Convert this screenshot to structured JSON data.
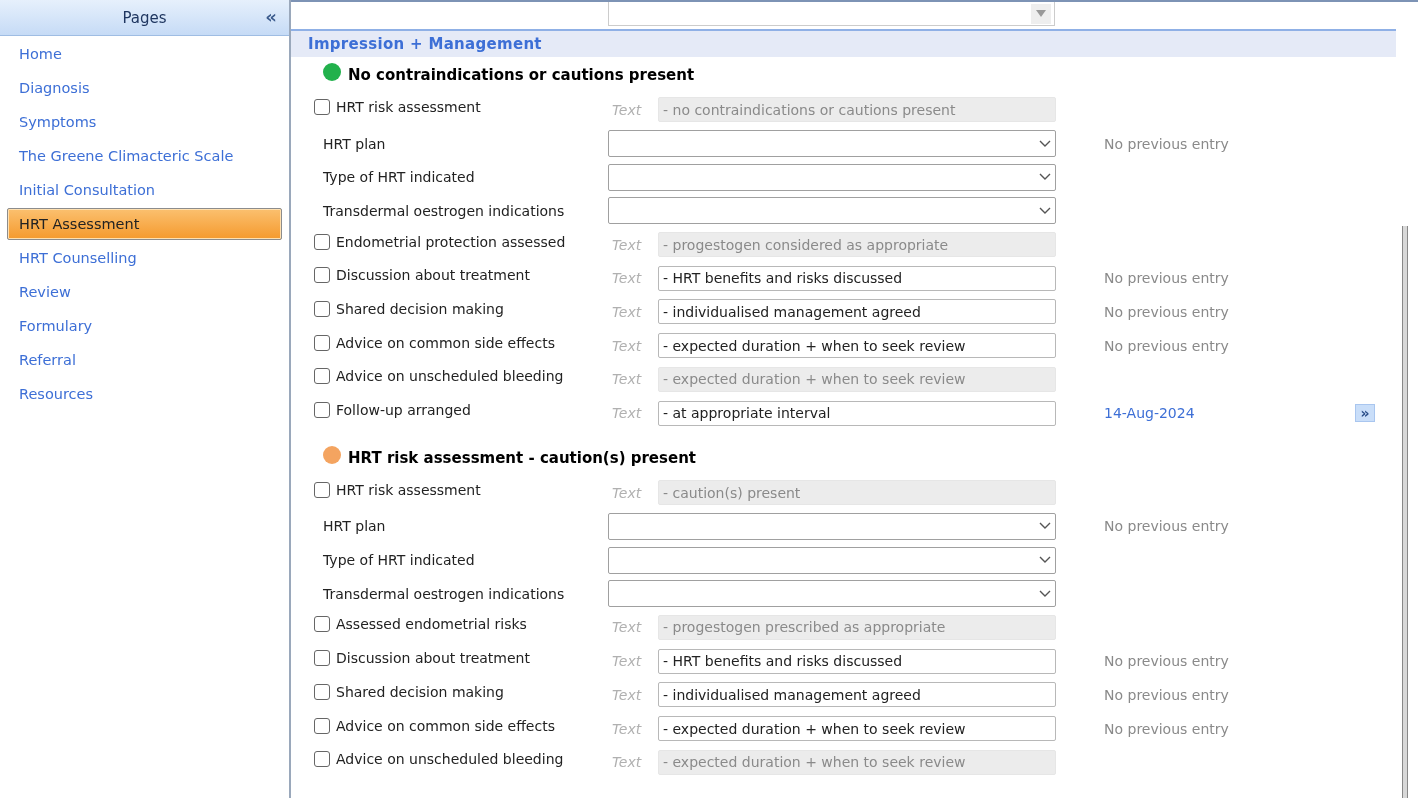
{
  "sidebar": {
    "title": "Pages",
    "collapse": "«",
    "items": [
      {
        "label": "Home",
        "selected": false
      },
      {
        "label": "Diagnosis",
        "selected": false
      },
      {
        "label": "Symptoms",
        "selected": false
      },
      {
        "label": "The Greene Climacteric Scale",
        "selected": false
      },
      {
        "label": "Initial Consultation",
        "selected": false
      },
      {
        "label": "HRT Assessment",
        "selected": true
      },
      {
        "label": "HRT Counselling",
        "selected": false
      },
      {
        "label": "Review",
        "selected": false
      },
      {
        "label": "Formulary",
        "selected": false
      },
      {
        "label": "Referral",
        "selected": false
      },
      {
        "label": "Resources",
        "selected": false
      }
    ]
  },
  "section": {
    "title": "Impression + Management"
  },
  "groups": [
    {
      "title": "No contraindications or cautions present",
      "color": "#22b14c",
      "rows": [
        {
          "kind": "check",
          "label": "HRT risk assessment",
          "checked": false,
          "hint": "Text",
          "value": "- no contraindications or cautions present",
          "readonly": true
        },
        {
          "kind": "select",
          "label": "HRT plan",
          "note": "No previous entry"
        },
        {
          "kind": "select",
          "label": "Type of HRT indicated"
        },
        {
          "kind": "select",
          "label": "Transdermal oestrogen indications"
        },
        {
          "kind": "check",
          "label": "Endometrial protection assessed",
          "checked": false,
          "hint": "Text",
          "value": "- progestogen considered as appropriate",
          "readonly": true
        },
        {
          "kind": "check",
          "label": "Discussion about treatment",
          "checked": false,
          "hint": "Text",
          "value": "- HRT benefits and risks discussed",
          "readonly": false,
          "note": "No previous entry"
        },
        {
          "kind": "check",
          "label": "Shared decision making",
          "checked": false,
          "hint": "Text",
          "value": "- individualised management agreed",
          "readonly": false,
          "note": "No previous entry"
        },
        {
          "kind": "check",
          "label": "Advice on common side effects",
          "checked": false,
          "hint": "Text",
          "value": "- expected duration + when to seek review",
          "readonly": false,
          "note": "No previous entry"
        },
        {
          "kind": "check",
          "label": "Advice on unscheduled bleeding",
          "checked": false,
          "hint": "Text",
          "value": "- expected duration + when to seek review",
          "readonly": true
        },
        {
          "kind": "check",
          "label": "Follow-up arranged",
          "checked": false,
          "hint": "Text",
          "value": "- at appropriate interval",
          "readonly": false,
          "date": "14-Aug-2024",
          "next_button": "»"
        }
      ]
    },
    {
      "title": "HRT risk assessment - caution(s) present",
      "color": "#f4a460",
      "rows": [
        {
          "kind": "check",
          "label": "HRT risk assessment",
          "checked": false,
          "hint": "Text",
          "value": "- caution(s) present",
          "readonly": true
        },
        {
          "kind": "select",
          "label": "HRT plan",
          "note": "No previous entry"
        },
        {
          "kind": "select",
          "label": "Type of HRT indicated"
        },
        {
          "kind": "select",
          "label": "Transdermal oestrogen indications"
        },
        {
          "kind": "check",
          "label": "Assessed endometrial risks",
          "checked": false,
          "hint": "Text",
          "value": "- progestogen prescribed as appropriate",
          "readonly": true
        },
        {
          "kind": "check",
          "label": "Discussion about treatment",
          "checked": false,
          "hint": "Text",
          "value": "- HRT benefits and risks discussed",
          "readonly": false,
          "note": "No previous entry"
        },
        {
          "kind": "check",
          "label": "Shared decision making",
          "checked": false,
          "hint": "Text",
          "value": "- individualised management agreed",
          "readonly": false,
          "note": "No previous entry"
        },
        {
          "kind": "check",
          "label": "Advice on common side effects",
          "checked": false,
          "hint": "Text",
          "value": "- expected duration + when to seek review",
          "readonly": false,
          "note": "No previous entry"
        },
        {
          "kind": "check",
          "label": "Advice on unscheduled bleeding",
          "checked": false,
          "hint": "Text",
          "value": "- expected duration + when to seek review",
          "readonly": true
        }
      ]
    }
  ]
}
